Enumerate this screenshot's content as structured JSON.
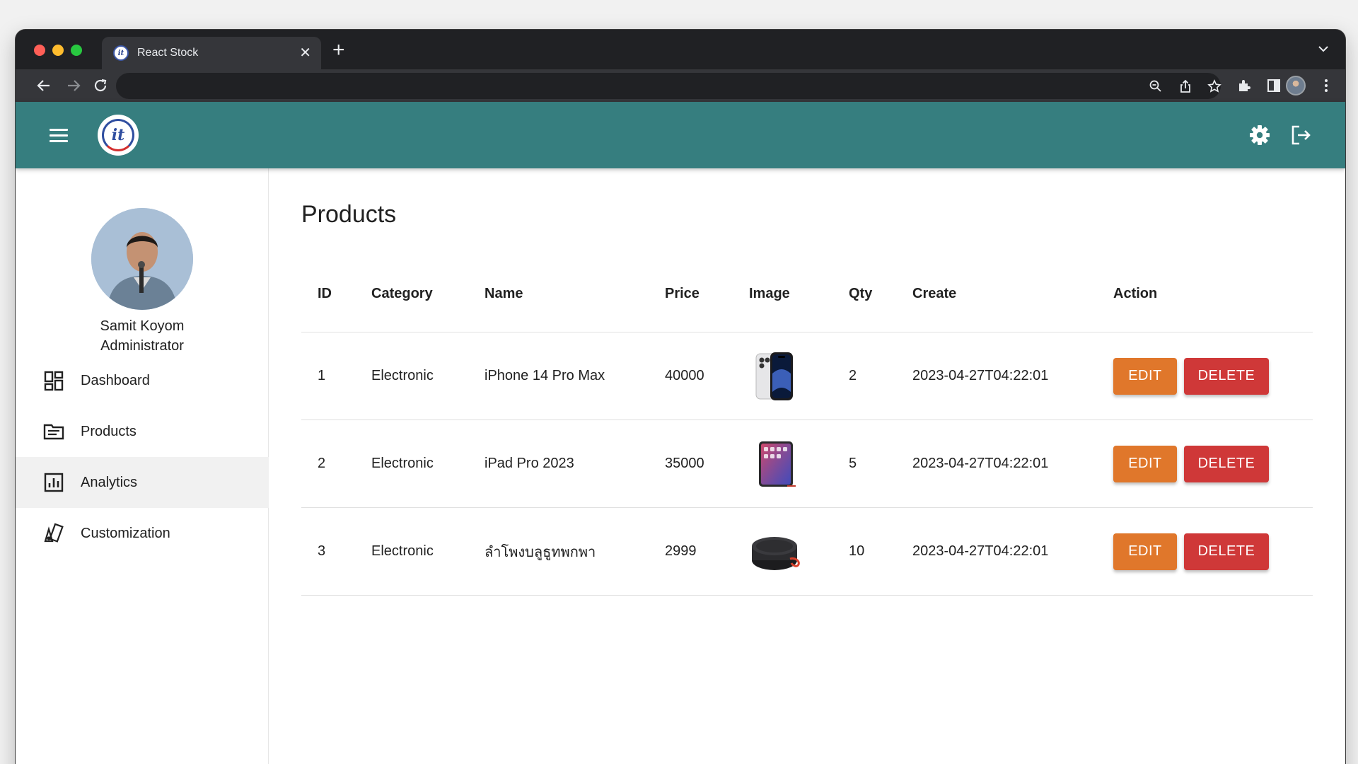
{
  "browser": {
    "tab_title": "React Stock",
    "tab_close": "✕",
    "new_tab": "+"
  },
  "user": {
    "name": "Samit Koyom",
    "role": "Administrator"
  },
  "sidebar": {
    "items": [
      {
        "label": "Dashboard",
        "icon": "dashboard-icon"
      },
      {
        "label": "Products",
        "icon": "products-icon"
      },
      {
        "label": "Analytics",
        "icon": "analytics-icon",
        "active": true
      },
      {
        "label": "Customization",
        "icon": "customization-icon"
      }
    ]
  },
  "main": {
    "title": "Products",
    "columns": [
      "ID",
      "Category",
      "Name",
      "Price",
      "Image",
      "Qty",
      "Create",
      "Action"
    ],
    "rows": [
      {
        "id": "1",
        "category": "Electronic",
        "name": "iPhone 14 Pro Max",
        "price": "40000",
        "image": "iphone-image",
        "qty": "2",
        "create": "2023-04-27T04:22:01"
      },
      {
        "id": "2",
        "category": "Electronic",
        "name": "iPad Pro 2023",
        "price": "35000",
        "image": "ipad-image",
        "qty": "5",
        "create": "2023-04-27T04:22:01"
      },
      {
        "id": "3",
        "category": "Electronic",
        "name": "ลำโพงบลูธูทพกพา",
        "price": "2999",
        "image": "speaker-image",
        "qty": "10",
        "create": "2023-04-27T04:22:01"
      }
    ],
    "edit_label": "EDIT",
    "delete_label": "DELETE"
  },
  "colors": {
    "appbar": "#367e7f",
    "edit": "#e0772b",
    "delete": "#cf3838"
  }
}
